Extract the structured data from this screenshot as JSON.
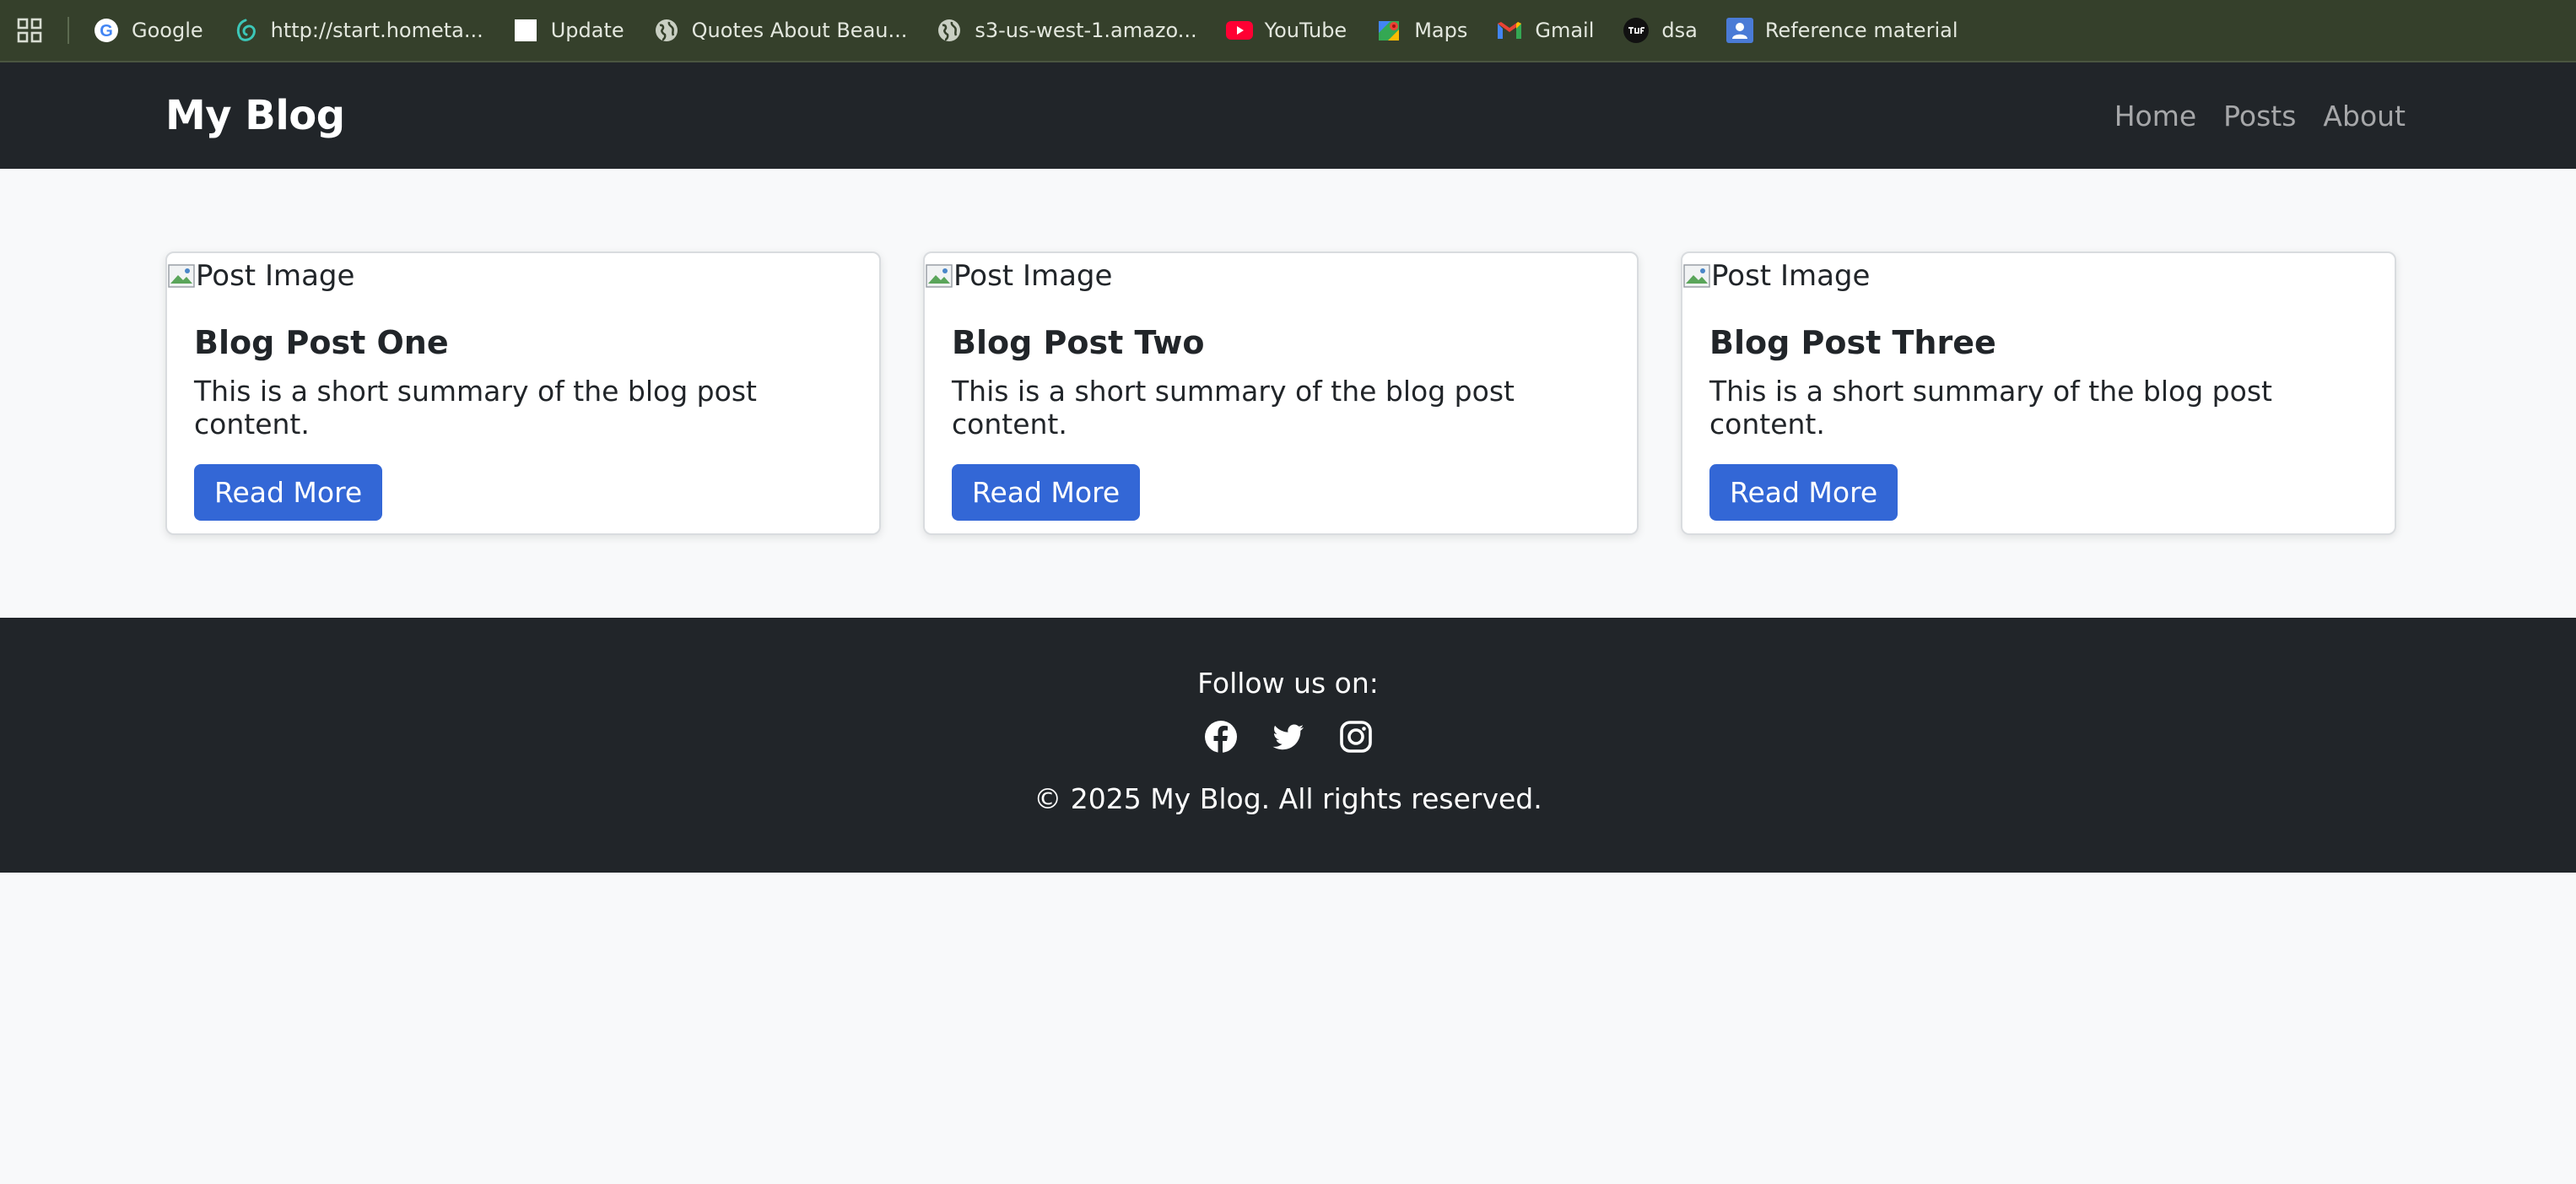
{
  "bookmarks": [
    {
      "label": "Google",
      "icon": "google-icon"
    },
    {
      "label": "http://start.hometa...",
      "icon": "hometab-icon"
    },
    {
      "label": "Update",
      "icon": "blank-page-icon"
    },
    {
      "label": "Quotes About Beau...",
      "icon": "globe-icon"
    },
    {
      "label": "s3-us-west-1.amazo...",
      "icon": "globe-icon"
    },
    {
      "label": "YouTube",
      "icon": "youtube-icon"
    },
    {
      "label": "Maps",
      "icon": "maps-icon"
    },
    {
      "label": "Gmail",
      "icon": "gmail-icon"
    },
    {
      "label": "dsa",
      "icon": "tuf-icon"
    },
    {
      "label": "Reference material",
      "icon": "classroom-icon"
    }
  ],
  "navbar": {
    "brand": "My Blog",
    "links": [
      "Home",
      "Posts",
      "About"
    ]
  },
  "posts": [
    {
      "image_alt": "Post Image",
      "title": "Blog Post One",
      "summary": "This is a short summary of the blog post content.",
      "button": "Read More"
    },
    {
      "image_alt": "Post Image",
      "title": "Blog Post Two",
      "summary": "This is a short summary of the blog post content.",
      "button": "Read More"
    },
    {
      "image_alt": "Post Image",
      "title": "Blog Post Three",
      "summary": "This is a short summary of the blog post content.",
      "button": "Read More"
    }
  ],
  "footer": {
    "follow": "Follow us on:",
    "social": [
      "facebook-icon",
      "twitter-icon",
      "instagram-icon"
    ],
    "copyright": "© 2025 My Blog. All rights reserved."
  },
  "colors": {
    "bookmarks_bg": "#35402b",
    "navbar_bg": "#212529",
    "page_bg": "#f8f9fa",
    "button_bg": "#3367d6"
  }
}
